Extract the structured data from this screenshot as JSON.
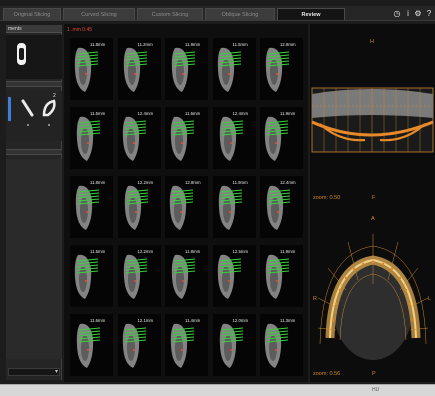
{
  "tabs": [
    {
      "label": "Original Slicing",
      "active": false
    },
    {
      "label": "Curved Slicing",
      "active": false
    },
    {
      "label": "Custom Slicing",
      "active": false
    },
    {
      "label": "Oblique Slicing",
      "active": false
    },
    {
      "label": "Review",
      "active": true
    }
  ],
  "toolbar": {
    "help_glyph": "?",
    "info_glyph": "i",
    "clock_glyph": "◷",
    "settings_glyph": "⚙"
  },
  "left_panel": {
    "header_title": "ments",
    "selector_number": "2"
  },
  "gallery": {
    "caption": "1 .mm 0.45",
    "thumbnails": [
      {
        "label": "11.8mm"
      },
      {
        "label": "11.2mm"
      },
      {
        "label": "11.9mm"
      },
      {
        "label": "11.5mm"
      },
      {
        "label": "12.8mm"
      },
      {
        "label": "11.5mm"
      },
      {
        "label": "12.4mm"
      },
      {
        "label": "11.5mm"
      },
      {
        "label": "12.4mm"
      },
      {
        "label": "11.9mm"
      },
      {
        "label": "11.8mm"
      },
      {
        "label": "12.2mm"
      },
      {
        "label": "12.8mm"
      },
      {
        "label": "11.9mm"
      },
      {
        "label": "12.4mm"
      },
      {
        "label": "11.5mm"
      },
      {
        "label": "12.2mm"
      },
      {
        "label": "11.8mm"
      },
      {
        "label": "12.5mm"
      },
      {
        "label": "11.9mm"
      },
      {
        "label": "11.6mm"
      },
      {
        "label": "12.1mm"
      },
      {
        "label": "11.4mm"
      },
      {
        "label": "12.0mm"
      },
      {
        "label": "11.3mm"
      }
    ]
  },
  "views": {
    "upper": {
      "top_letter": "H",
      "bottom_letter": "F",
      "zoom": "zoom: 0.50"
    },
    "lower": {
      "top_letter": "A",
      "left_letter": "R",
      "right_letter": "L",
      "bottom_letter": "P",
      "zoom": "zoom: 0.56"
    }
  },
  "status": {
    "text": "HU"
  },
  "colors": {
    "accent": "#d28a2c",
    "implant": "#36d63a",
    "alert": "#e04a3a",
    "background": "#1c1c1c"
  }
}
